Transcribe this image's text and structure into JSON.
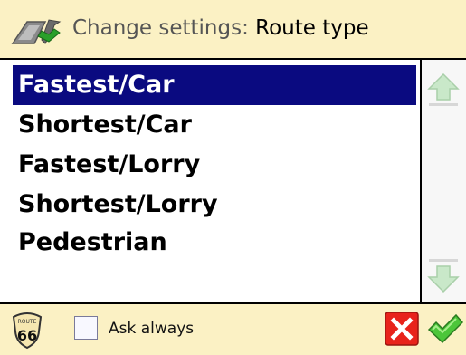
{
  "header": {
    "prefix": "Change settings:",
    "value": "Route type",
    "icon": "settings-wrench-icon"
  },
  "route_types": {
    "items": [
      {
        "label": "Fastest/Car",
        "selected": true
      },
      {
        "label": "Shortest/Car",
        "selected": false
      },
      {
        "label": "Fastest/Lorry",
        "selected": false
      },
      {
        "label": "Shortest/Lorry",
        "selected": false
      },
      {
        "label": "Pedestrian",
        "selected": false
      }
    ]
  },
  "scrollbar": {
    "up_icon": "arrow-up-icon",
    "down_icon": "arrow-down-icon"
  },
  "footer": {
    "logo_icon": "route-66-sign-icon",
    "ask_always_label": "Ask always",
    "ask_always_checked": false,
    "cancel_icon": "red-x-icon",
    "ok_icon": "green-check-icon"
  },
  "colors": {
    "bar_background": "#fbf1c4",
    "selection": "#0a0a80"
  }
}
